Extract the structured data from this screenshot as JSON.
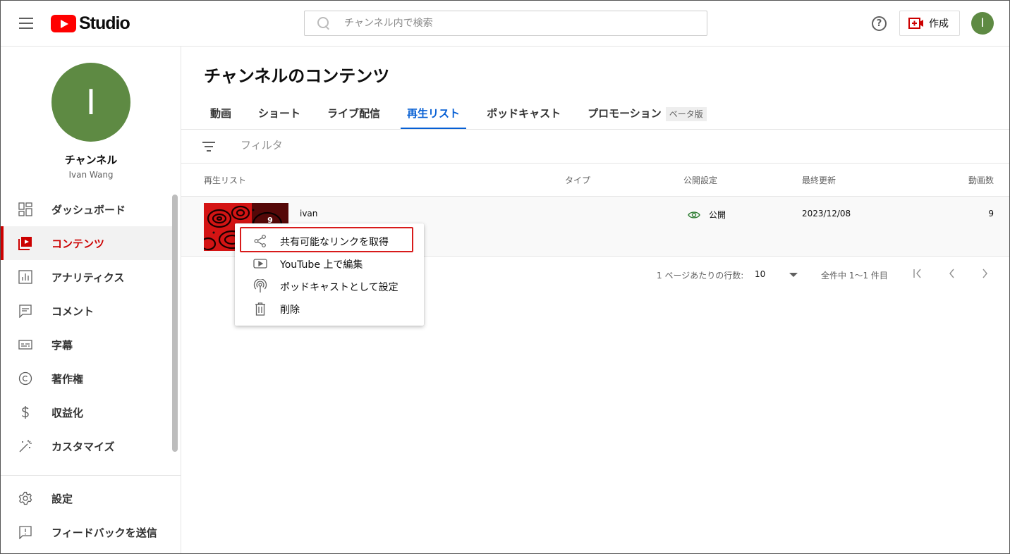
{
  "header": {
    "logo_text": "Studio",
    "search_placeholder": "チャンネル内で検索",
    "help_glyph": "?",
    "create_label": "作成",
    "avatar_letter": "I"
  },
  "sidebar": {
    "avatar_letter": "I",
    "channel_title": "チャンネル",
    "channel_name": "Ivan Wang",
    "items": [
      {
        "label": "ダッシュボード",
        "icon": "dashboard-icon"
      },
      {
        "label": "コンテンツ",
        "icon": "content-icon",
        "active": true
      },
      {
        "label": "アナリティクス",
        "icon": "analytics-icon"
      },
      {
        "label": "コメント",
        "icon": "comments-icon"
      },
      {
        "label": "字幕",
        "icon": "subtitles-icon"
      },
      {
        "label": "著作権",
        "icon": "copyright-icon"
      },
      {
        "label": "収益化",
        "icon": "dollar-icon"
      },
      {
        "label": "カスタマイズ",
        "icon": "magic-wand-icon"
      }
    ],
    "bottom_items": [
      {
        "label": "設定",
        "icon": "gear-icon"
      },
      {
        "label": "フィードバックを送信",
        "icon": "feedback-icon"
      }
    ]
  },
  "main": {
    "title": "チャンネルのコンテンツ",
    "tabs": [
      {
        "label": "動画"
      },
      {
        "label": "ショート"
      },
      {
        "label": "ライブ配信"
      },
      {
        "label": "再生リスト",
        "active": true
      },
      {
        "label": "ポッドキャスト"
      },
      {
        "label": "プロモーション",
        "badge": "ベータ版"
      }
    ],
    "filter_placeholder": "フィルタ",
    "columns": [
      "再生リスト",
      "タイプ",
      "公開設定",
      "最終更新",
      "動画数"
    ],
    "rows": [
      {
        "title": "ivan",
        "thumb_count": "9",
        "type": "",
        "visibility": "公開",
        "updated": "2023/12/08",
        "video_count": "9"
      }
    ],
    "pager": {
      "rows_per_page_label": "1 ページあたりの行数:",
      "rows_per_page": "10",
      "range": "全件中 1〜1 件目"
    }
  },
  "context_menu": {
    "items": [
      {
        "label": "共有可能なリンクを取得",
        "icon": "share-icon",
        "highlighted": true
      },
      {
        "label": "YouTube 上で編集",
        "icon": "youtube-icon"
      },
      {
        "label": "ポッドキャストとして設定",
        "icon": "podcast-icon"
      },
      {
        "label": "削除",
        "icon": "trash-icon"
      }
    ]
  },
  "colors": {
    "brand_red": "#ff0000",
    "active_red": "#cc0000",
    "tab_blue": "#065fd4",
    "avatar_green": "#5e8a43",
    "highlight_border": "#d81b1b"
  }
}
